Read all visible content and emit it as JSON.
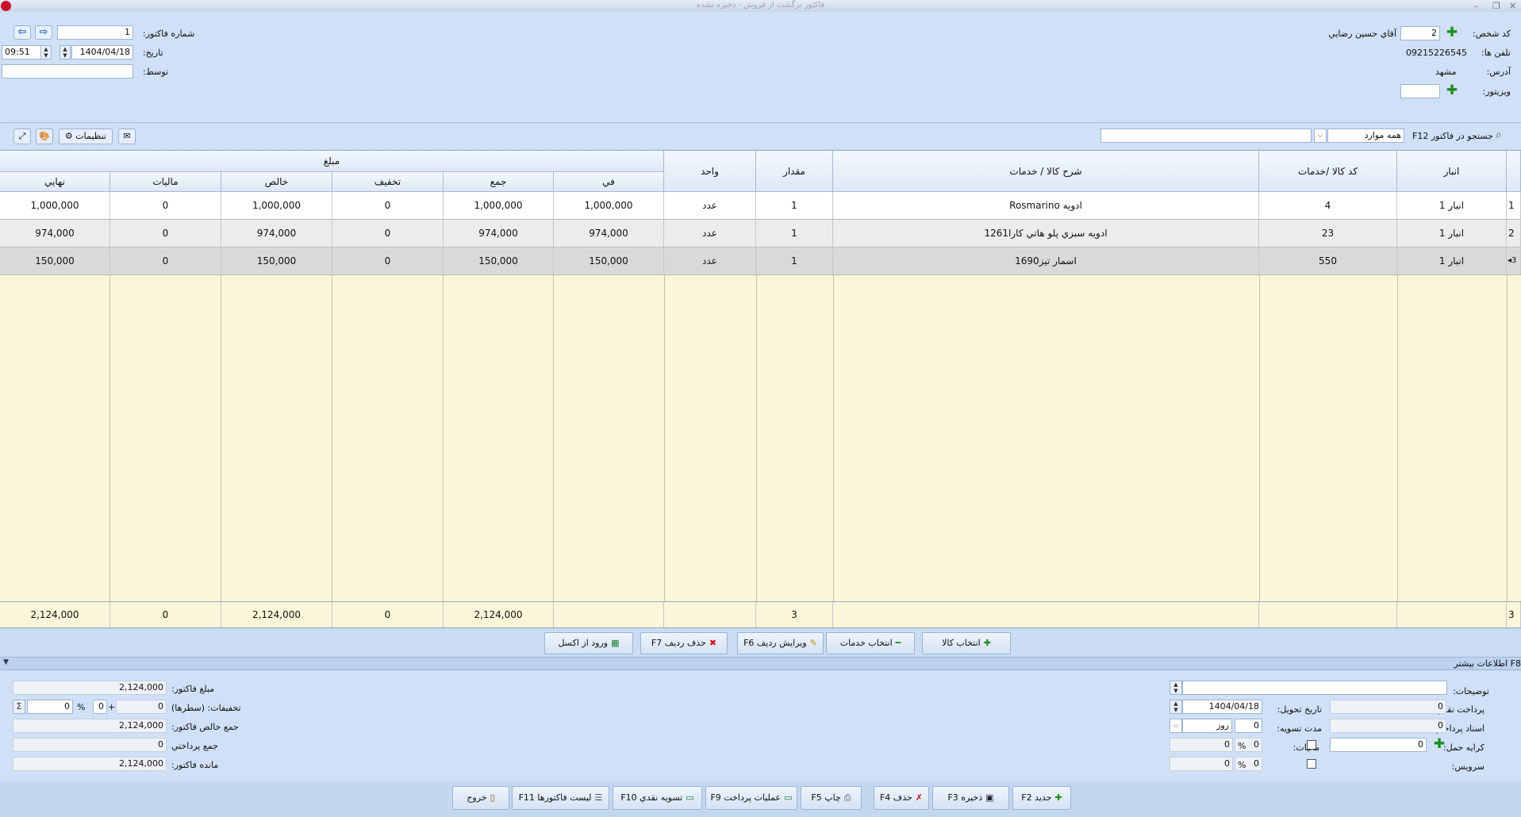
{
  "window": {
    "title": "فاکتور برگشت از فروش - ذخیره نشده"
  },
  "header": {
    "customer_code_label": "کد شخص:",
    "customer_code": "2",
    "customer_name": "آقاي حسين  رضايي",
    "phones_label": "تلفن ها:",
    "phones": "09215226545",
    "address_label": "آدرس:",
    "address": "مشهد",
    "visitor_label": "ويزيتور:",
    "visitor": "",
    "invoice_no_label": "شماره فاکتور:",
    "invoice_no": "1",
    "date_label": "تاريخ:",
    "date": "1404/04/18",
    "time": "09:51",
    "by_label": "توسط:",
    "by": ""
  },
  "toolbar": {
    "settings_label": "تنظيمات",
    "search_label": "جستجو در فاکتور F12",
    "search_scope": "همه موارد",
    "search_value": ""
  },
  "grid": {
    "group_header": "مبلغ",
    "columns": {
      "store": "انبار",
      "code": "کد کالا /خدمات",
      "desc": "شرح کالا / خدمات",
      "qty": "مقدار",
      "unit": "واحد",
      "unit_price": "في",
      "sum": "جمع",
      "discount": "تخفيف",
      "net": "خالص",
      "tax": "ماليات",
      "final": "نهايي"
    },
    "rows": [
      {
        "num": "1",
        "store": "انبار 1",
        "code": "4",
        "desc": "ادويه Rosmarino",
        "qty": "1",
        "unit": "عدد",
        "unit_price": "1,000,000",
        "sum": "1,000,000",
        "discount": "0",
        "net": "1,000,000",
        "tax": "0",
        "final": "1,000,000"
      },
      {
        "num": "2",
        "store": "انبار 1",
        "code": "23",
        "desc": "ادويه سبزي پلو هاتي کارا1261",
        "qty": "1",
        "unit": "عدد",
        "unit_price": "974,000",
        "sum": "974,000",
        "discount": "0",
        "net": "974,000",
        "tax": "0",
        "final": "974,000"
      },
      {
        "num": "3",
        "store": "انبار 1",
        "code": "550",
        "desc": "اسمار تيز1690",
        "qty": "1",
        "unit": "عدد",
        "unit_price": "150,000",
        "sum": "150,000",
        "discount": "0",
        "net": "150,000",
        "tax": "0",
        "final": "150,000"
      }
    ],
    "totals": {
      "count": "3",
      "qty": "3",
      "sum": "2,124,000",
      "discount": "0",
      "net": "2,124,000",
      "tax": "0",
      "final": "2,124,000"
    }
  },
  "actions": {
    "select_goods": "انتخاب کالا",
    "select_services": "انتخاب خدمات",
    "edit_row": "ويرايش رديف F6",
    "delete_row": "حذف رديف F7",
    "import_excel": "ورود از اکسل"
  },
  "more_info": {
    "label": "F8 اطلاعات بيشتر"
  },
  "bottom": {
    "notes_label": "توضيحات:",
    "notes": "",
    "cash_label": "پرداخت نقدي:",
    "cash": "0",
    "delivery_date_label": "تاريخ تحويل:",
    "delivery_date": "1404/04/18",
    "payment_docs_label": "اسناد پرداختي:",
    "payment_docs": "0",
    "settle_period_label": "مدت تسويه:",
    "settle_period": "0",
    "settle_unit": "روز",
    "freight_label": "کرايه حمل:",
    "freight": "0",
    "tax_label": "ماليات:",
    "tax_amount": "0",
    "service_label": "سرويس:",
    "service_amount": "0",
    "percent": "%",
    "invoice_amount_label": "مبلغ فاکتور:",
    "invoice_amount": "2,124,000",
    "discounts_label": "تخفيفات: (سطرها)",
    "discount_rows": "0",
    "discount_extra": "0",
    "discount_percent": "0",
    "net_total_label": "جمع خالص فاکتور:",
    "net_total": "2,124,000",
    "paid_total_label": "جمع پرداختي",
    "paid_total": "0",
    "remaining_label": "مانده فاکتور:",
    "remaining": "2,124,000"
  },
  "footer": {
    "new": "جديد F2",
    "save": "ذخيره F3",
    "delete": "حذف F4",
    "print": "چاپ F5",
    "payment_ops": "عمليات پرداخت F9",
    "cash_settle": "تسويه نقدي F10",
    "invoice_list": "ليست فاکتورها F11",
    "exit": "خروج"
  }
}
